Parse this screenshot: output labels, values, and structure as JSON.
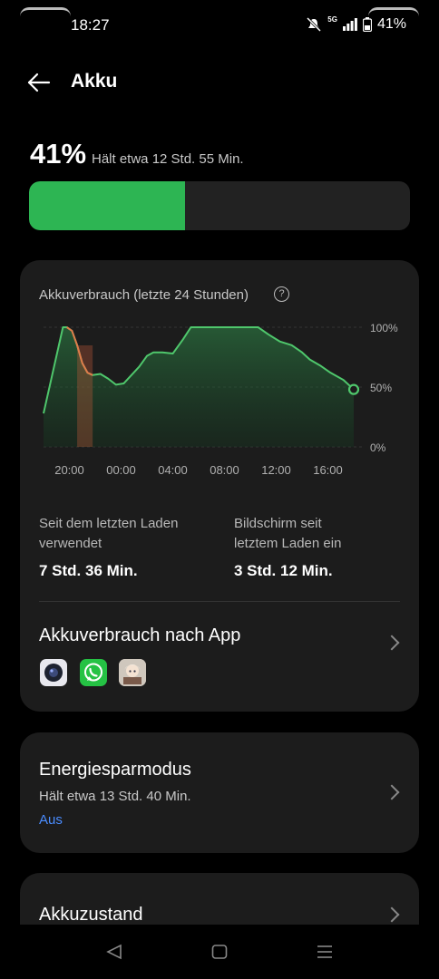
{
  "status_bar": {
    "time": "18:27",
    "network": "5G",
    "battery": "41%"
  },
  "header": {
    "title": "Akku"
  },
  "battery": {
    "percent_label": "41%",
    "remaining": "Hält etwa 12 Std. 55 Min.",
    "level": 0.41,
    "fill_color": "#2db553"
  },
  "usage_card": {
    "chart_title": "Akkuverbrauch (letzte 24 Stunden)",
    "help_icon": "question-icon",
    "stats": [
      {
        "label_line1": "Seit dem letzten Laden",
        "label_line2": "verwendet",
        "value": "7 Std. 36 Min."
      },
      {
        "label_line1": "Bildschirm seit",
        "label_line2": "letztem Laden ein",
        "value": "3 Std. 12 Min."
      }
    ],
    "app_usage_title": "Akkuverbrauch nach App",
    "apps": [
      {
        "name": "camera-app-icon"
      },
      {
        "name": "whatsapp-app-icon"
      },
      {
        "name": "game-app-icon"
      }
    ]
  },
  "power_saving": {
    "title": "Energiesparmodus",
    "subtitle": "Hält etwa 13 Std. 40 Min.",
    "state": "Aus"
  },
  "battery_health": {
    "title": "Akkuzustand"
  },
  "chart_data": {
    "type": "area",
    "title": "Akkuverbrauch (letzte 24 Stunden)",
    "x_ticks": [
      "20:00",
      "00:00",
      "04:00",
      "08:00",
      "12:00",
      "16:00"
    ],
    "y_ticks": [
      "100%",
      "50%",
      "0%"
    ],
    "ylim": [
      0,
      100
    ],
    "xlim_hours": [
      0,
      24
    ],
    "series": [
      {
        "x": [
          0,
          1.5,
          1.8,
          2.2,
          2.6,
          3.0,
          3.4,
          3.8,
          4.4,
          5.0,
          5.6,
          6.2,
          6.8,
          7.4,
          8.0,
          8.5,
          9.2,
          10.0,
          10.8,
          11.4,
          12.2,
          13.2,
          14.5,
          15.7,
          16.6,
          17.4,
          18.3,
          19.2,
          20.0,
          20.6,
          21.4,
          22.2,
          23.2,
          24.0
        ],
        "values": [
          28,
          100,
          100,
          97,
          85,
          70,
          62,
          60,
          61,
          57,
          52,
          53,
          60,
          67,
          76,
          79,
          79,
          78,
          90,
          100,
          100,
          100,
          100,
          100,
          100,
          94,
          88,
          85,
          79,
          73,
          68,
          62,
          56,
          48
        ]
      }
    ],
    "charging_highlight": {
      "from": 2.6,
      "to": 3.8,
      "color": "#c0583a"
    },
    "line_color": "#4fc76c"
  }
}
